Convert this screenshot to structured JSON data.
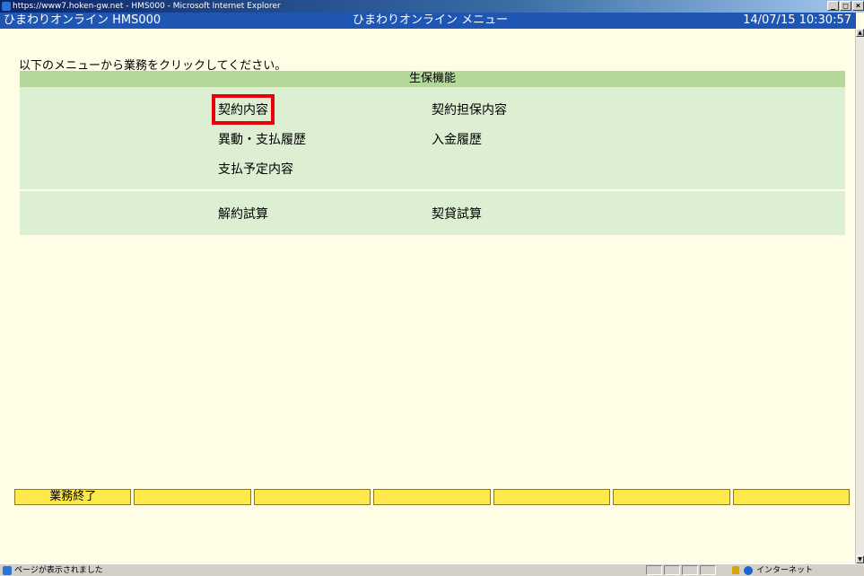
{
  "window": {
    "title": "https://www7.hoken-gw.net - HMS000 - Microsoft Internet Explorer",
    "min_label": "_",
    "max_label": "□",
    "close_label": "×"
  },
  "header": {
    "app_name": "ひまわりオンライン HMS000",
    "page_title": "ひまわりオンライン メニュー",
    "datetime": "14/07/15 10:30:57"
  },
  "instruction": "以下のメニューから業務をクリックしてください。",
  "panel": {
    "heading": "生保機能",
    "items": [
      {
        "label": "契約内容"
      },
      {
        "label": "契約担保内容"
      },
      {
        "label": "異動・支払履歴"
      },
      {
        "label": "入金履歴"
      },
      {
        "label": "支払予定内容"
      },
      {
        "label": "解約試算"
      },
      {
        "label": "契貸試算"
      }
    ]
  },
  "function_keys": [
    "業務終了",
    "",
    "",
    "",
    "",
    "",
    ""
  ],
  "status_bar": {
    "message": "ページが表示されました",
    "zone": "インターネット"
  },
  "scrollbar": {
    "up_arrow": "▲",
    "down_arrow": "▼"
  },
  "colors": {
    "header_blue": "#1f56b4",
    "panel_green": "#dcefd2",
    "panel_head_green": "#b3d89a",
    "fkey_yellow": "#ffe94a",
    "highlight_red": "#e8000b"
  }
}
